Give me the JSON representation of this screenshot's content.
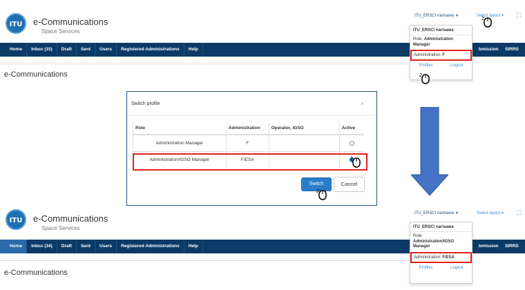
{
  "top": {
    "logo": "ITU",
    "brand_title": "e-Communications",
    "brand_sub": "Space Services",
    "user": "ITU_ERSC\\  narisawa",
    "select_layout": "Select layout ▾",
    "nav": [
      "Home",
      "Inbox (15)",
      "Draft",
      "Sent",
      "Users",
      "Registered Administrations",
      "Help"
    ],
    "nav_right": [
      "bmission",
      "SIRRS"
    ],
    "page_heading": "e-Communications",
    "menu": {
      "user": "ITU_ERSC\\  narisawa",
      "role_label": "Role:",
      "role": "Administration Manager",
      "admin_label": "Administration:",
      "admin": "F",
      "profiles": "Profiles",
      "logout": "Logout"
    }
  },
  "modal": {
    "title": "Switch profile",
    "close": "×",
    "headers": [
      "Role",
      "Administration",
      "Operator, IGSO",
      "Active"
    ],
    "rows": [
      {
        "role": "Administration Manager",
        "admin": "F",
        "operator": "",
        "active": false
      },
      {
        "role": "Administration/IGSO Manager",
        "admin": "F/ESA",
        "operator": "",
        "active": true
      }
    ],
    "switch": "Switch",
    "cancel": "Cancel"
  },
  "bottom": {
    "logo": "ITU",
    "brand_title": "e-Communications",
    "brand_sub": "Space Services",
    "user": "ITU_ERSC\\  narisawa",
    "select_layout": "Select layout ▾",
    "nav": [
      "Home",
      "Inbox (34)",
      "Draft",
      "Sent",
      "Users",
      "Registered Administrations",
      "Help"
    ],
    "nav_right": [
      "bmission",
      "SIRRS"
    ],
    "page_heading": "e-Communications",
    "menu": {
      "user": "ITU_ERSC\\  narisawa",
      "role_label": "Role:",
      "role": "Administration/IGSO Manager",
      "admin_label": "Administration:",
      "admin": "F/ESA",
      "profiles": "Profiles",
      "logout": "Logout"
    }
  },
  "colors": {
    "nav_bg": "#0b3a66",
    "nav_active": "#2a6aa8",
    "highlight": "#e02020",
    "arrow": "#4472c4",
    "switch_button": "#2a7dc9"
  }
}
